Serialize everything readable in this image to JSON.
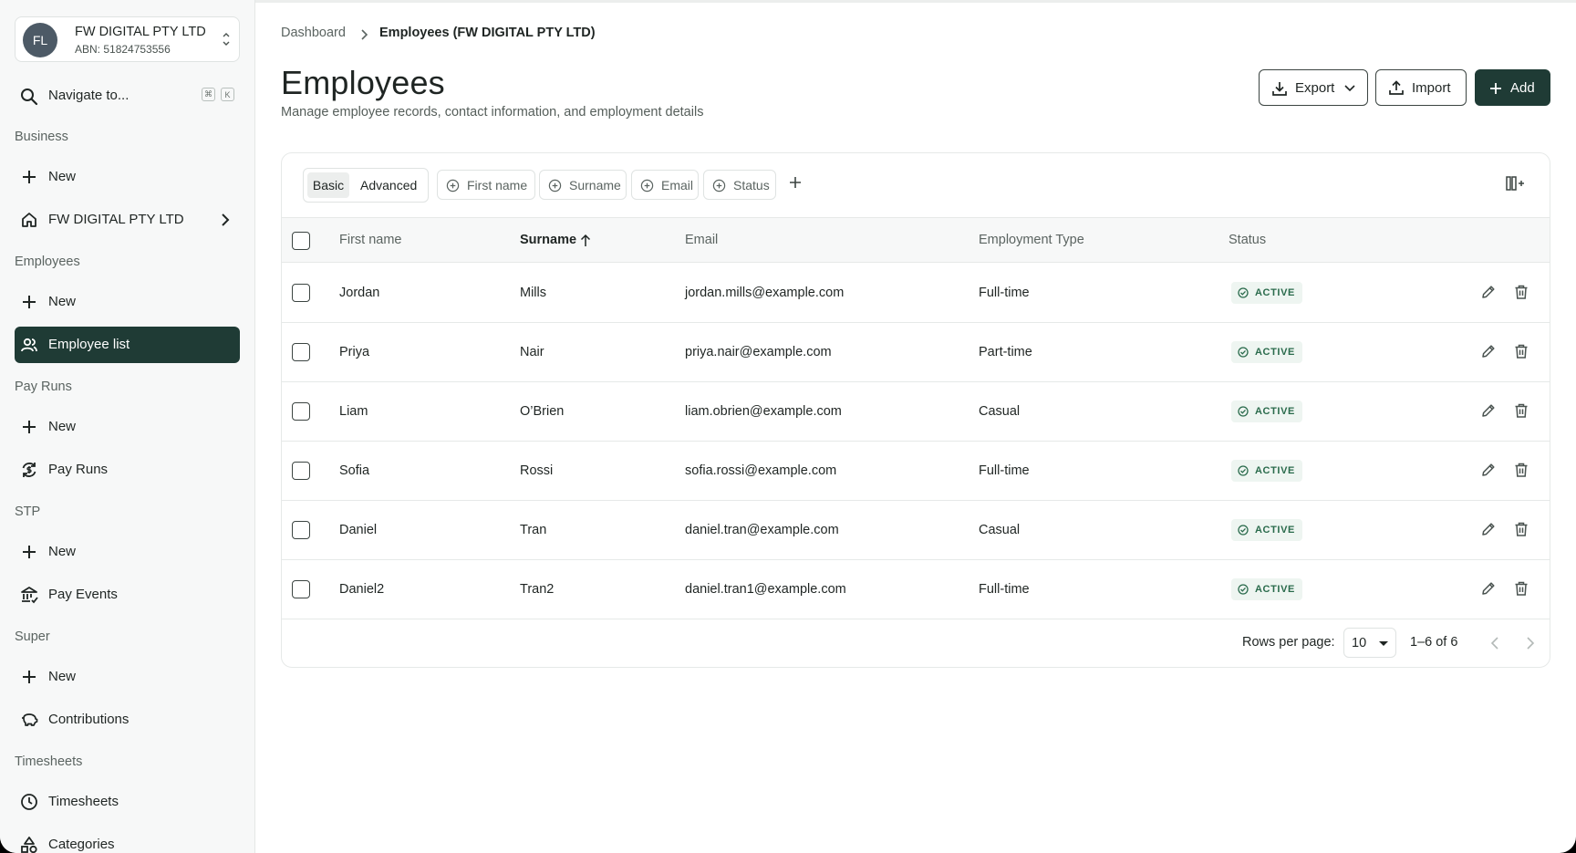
{
  "sidebar": {
    "org": {
      "initials": "FL",
      "name": "FW DIGITAL PTY LTD",
      "abn": "ABN: 51824753556"
    },
    "search": {
      "label": "Navigate to...",
      "kbd1": "⌘",
      "kbd2": "K"
    },
    "sections": {
      "business": "Business",
      "employees": "Employees",
      "pay_runs": "Pay Runs",
      "stp": "STP",
      "super": "Super",
      "timesheets": "Timesheets"
    },
    "items": {
      "business_new": "New",
      "business_org": "FW DIGITAL PTY LTD",
      "employees_new": "New",
      "employee_list": "Employee list",
      "payruns_new": "New",
      "pay_runs": "Pay Runs",
      "stp_new": "New",
      "pay_events": "Pay Events",
      "super_new": "New",
      "contributions": "Contributions",
      "timesheets": "Timesheets",
      "categories": "Categories"
    }
  },
  "breadcrumb": {
    "root": "Dashboard",
    "current": "Employees (FW DIGITAL PTY LTD)"
  },
  "page": {
    "title": "Employees",
    "subtitle": "Manage employee records, contact information, and employment details"
  },
  "toolbar": {
    "export": "Export",
    "import": "Import",
    "add": "Add"
  },
  "filters": {
    "basic": "Basic",
    "advanced": "Advanced",
    "chips": [
      "First name",
      "Surname",
      "Email",
      "Status"
    ]
  },
  "table": {
    "columns": {
      "first_name": "First name",
      "surname": "Surname",
      "email": "Email",
      "employment_type": "Employment Type",
      "status": "Status"
    },
    "rows": [
      {
        "first": "Jordan",
        "surname": "Mills",
        "email": "jordan.mills@example.com",
        "type": "Full-time",
        "status": "ACTIVE"
      },
      {
        "first": "Priya",
        "surname": "Nair",
        "email": "priya.nair@example.com",
        "type": "Part-time",
        "status": "ACTIVE"
      },
      {
        "first": "Liam",
        "surname": "O’Brien",
        "email": "liam.obrien@example.com",
        "type": "Casual",
        "status": "ACTIVE"
      },
      {
        "first": "Sofia",
        "surname": "Rossi",
        "email": "sofia.rossi@example.com",
        "type": "Full-time",
        "status": "ACTIVE"
      },
      {
        "first": "Daniel",
        "surname": "Tran",
        "email": "daniel.tran@example.com",
        "type": "Casual",
        "status": "ACTIVE"
      },
      {
        "first": "Daniel2",
        "surname": "Tran2",
        "email": "daniel.tran1@example.com",
        "type": "Full-time",
        "status": "ACTIVE"
      }
    ]
  },
  "pagination": {
    "rows_label": "Rows per page:",
    "rows_value": "10",
    "range": "1–6 of 6"
  },
  "colors": {
    "brand": "#1f3b35",
    "status_active": "#2a6b4c"
  }
}
